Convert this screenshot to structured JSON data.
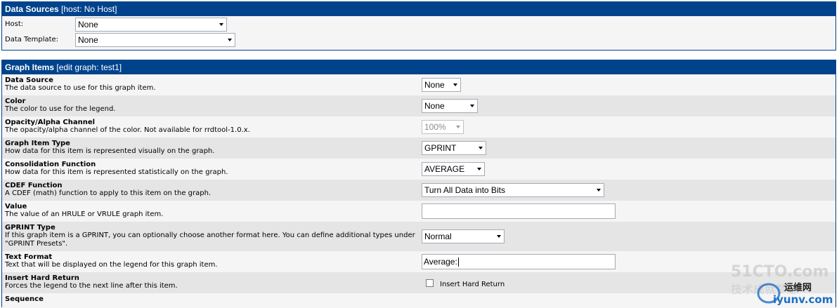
{
  "data_sources": {
    "header_title": "Data Sources",
    "header_context": "[host: No Host]",
    "host_label": "Host:",
    "host_value": "None",
    "template_label": "Data Template:",
    "template_value": "None"
  },
  "graph_items": {
    "header_title": "Graph Items",
    "header_context": "[edit graph: test1]",
    "rows": [
      {
        "title": "Data Source",
        "desc": "The data source to use for this graph item.",
        "value": "None"
      },
      {
        "title": "Color",
        "desc": "The color to use for the legend.",
        "value": "None"
      },
      {
        "title": "Opacity/Alpha Channel",
        "desc": "The opacity/alpha channel of the color. Not available for rrdtool-1.0.x.",
        "value": "100%"
      },
      {
        "title": "Graph Item Type",
        "desc": "How data for this item is represented visually on the graph.",
        "value": "GPRINT"
      },
      {
        "title": "Consolidation Function",
        "desc": "How data for this item is represented statistically on the graph.",
        "value": "AVERAGE"
      },
      {
        "title": "CDEF Function",
        "desc": "A CDEF (math) function to apply to this item on the graph.",
        "value": "Turn All Data into Bits"
      },
      {
        "title": "Value",
        "desc": "The value of an HRULE or VRULE graph item.",
        "value": ""
      },
      {
        "title": "GPRINT Type",
        "desc": "If this graph item is a GPRINT, you can optionally choose another format here. You can define additional types under \"GPRINT Presets\".",
        "value": "Normal"
      },
      {
        "title": "Text Format",
        "desc": "Text that will be displayed on the legend for this graph item.",
        "value": "Average:"
      },
      {
        "title": "Insert Hard Return",
        "desc": "Forces the legend to the next line after this item.",
        "value": "Insert Hard Return"
      },
      {
        "title": "Sequence",
        "desc": "",
        "value": ""
      }
    ]
  },
  "watermark": {
    "site": "51CTO.com",
    "tagline": "技术成就梦想",
    "brand": "运维网",
    "url": "iyunv.com"
  },
  "colors": {
    "header_bg": "#00438c",
    "row_light": "#f5f5f5",
    "row_dark": "#e5e5e5"
  }
}
